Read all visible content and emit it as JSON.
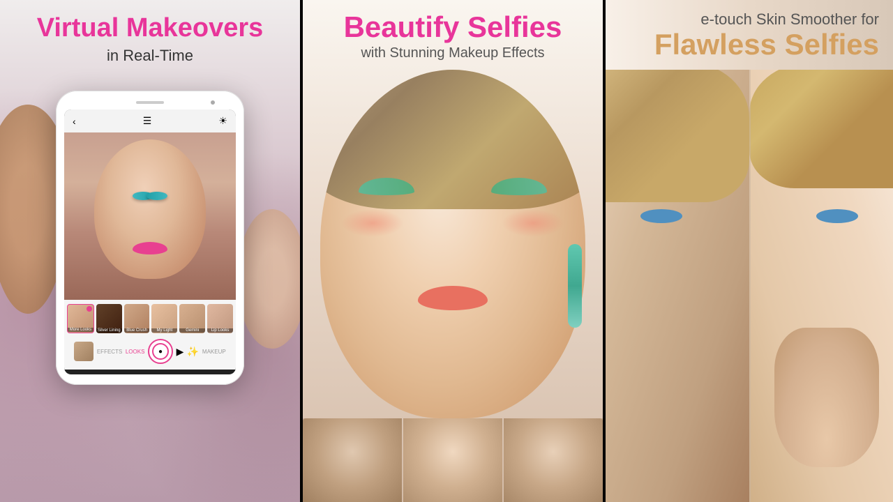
{
  "panels": {
    "panel1": {
      "title": "Virtual Makeovers",
      "subtitle": "in Real-Time",
      "phone": {
        "nav": {
          "effects": "EFFECTS",
          "looks": "LOOKS",
          "makeup": "MAKEUP"
        },
        "looks": [
          {
            "label": "More Looks",
            "class": "lt1",
            "has_dot": true
          },
          {
            "label": "Silver Lining",
            "class": "lt2",
            "has_dot": false
          },
          {
            "label": "Blue Crush",
            "class": "lt3",
            "has_dot": false
          },
          {
            "label": "My Light",
            "class": "lt4",
            "has_dot": false
          },
          {
            "label": "Gemini",
            "class": "lt5",
            "has_dot": false
          },
          {
            "label": "Lip Looks",
            "class": "lt6",
            "has_dot": false
          }
        ]
      }
    },
    "panel2": {
      "title": "Beautify Selfies",
      "subtitle": "with Stunning Makeup Effects"
    },
    "panel3": {
      "subtitle": "e-touch Skin Smoother for",
      "title": "Flawless Selfies"
    }
  }
}
